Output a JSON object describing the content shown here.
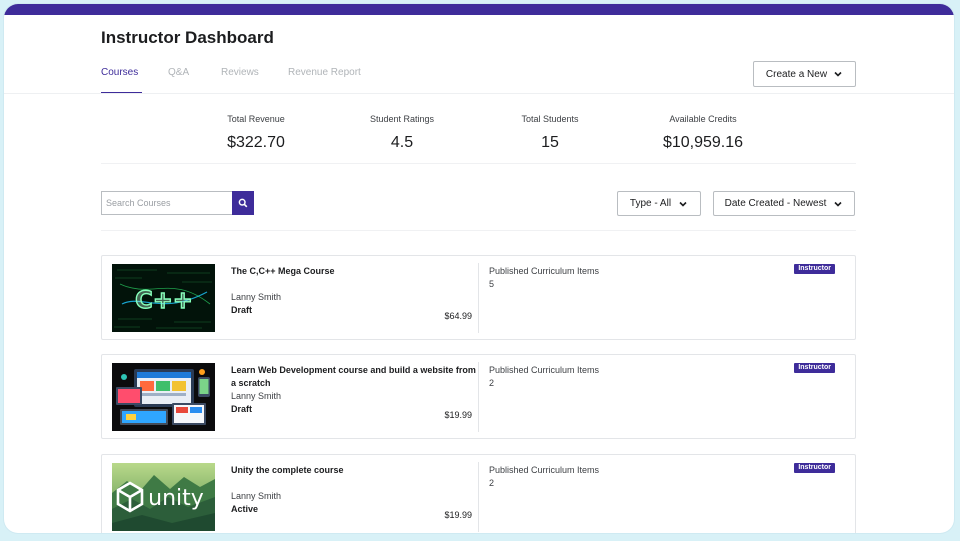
{
  "header": {
    "title": "Instructor Dashboard",
    "tabs": [
      {
        "label": "Courses",
        "active": true
      },
      {
        "label": "Q&A",
        "active": false
      },
      {
        "label": "Reviews",
        "active": false
      },
      {
        "label": "Revenue Report",
        "active": false
      }
    ],
    "create_button_label": "Create a New",
    "create_button_icon": "chevron-down-icon"
  },
  "stats": [
    {
      "label": "Total Revenue",
      "value": "$322.70"
    },
    {
      "label": "Student Ratings",
      "value": "4.5"
    },
    {
      "label": "Total Students",
      "value": "15"
    },
    {
      "label": "Available Credits",
      "value": "$10,959.16"
    }
  ],
  "toolbar": {
    "search_placeholder": "Search Courses",
    "search_value": "",
    "search_icon": "search-icon",
    "type_filter_label": "Type - All",
    "sort_label": "Date Created - Newest"
  },
  "courses": [
    {
      "title": "The C,C++ Mega Course",
      "author": "Lanny Smith",
      "status": "Draft",
      "price": "$64.99",
      "curriculum_label": "Published Curriculum Items",
      "curriculum_count": "5",
      "badge": "Instructor",
      "thumbnail": {
        "label": "C++",
        "icon": "cpp-thumbnail"
      }
    },
    {
      "title": "Learn Web Development course and build a website from a scratch",
      "author": "Lanny Smith",
      "status": "Draft",
      "price": "$19.99",
      "curriculum_label": "Published Curriculum Items",
      "curriculum_count": "2",
      "badge": "Instructor",
      "thumbnail": {
        "icon": "web-devices-thumbnail"
      }
    },
    {
      "title": "Unity the complete course",
      "author": "Lanny Smith",
      "status": "Active",
      "price": "$19.99",
      "curriculum_label": "Published Curriculum Items",
      "curriculum_count": "2",
      "badge": "Instructor",
      "thumbnail": {
        "label": "unity",
        "icon": "unity-thumbnail"
      }
    }
  ],
  "colors": {
    "brand": "#3e2c9a",
    "frame_background": "#d8f1f7",
    "text": "#1c1d1f",
    "muted_tab": "#b0b4b8"
  }
}
